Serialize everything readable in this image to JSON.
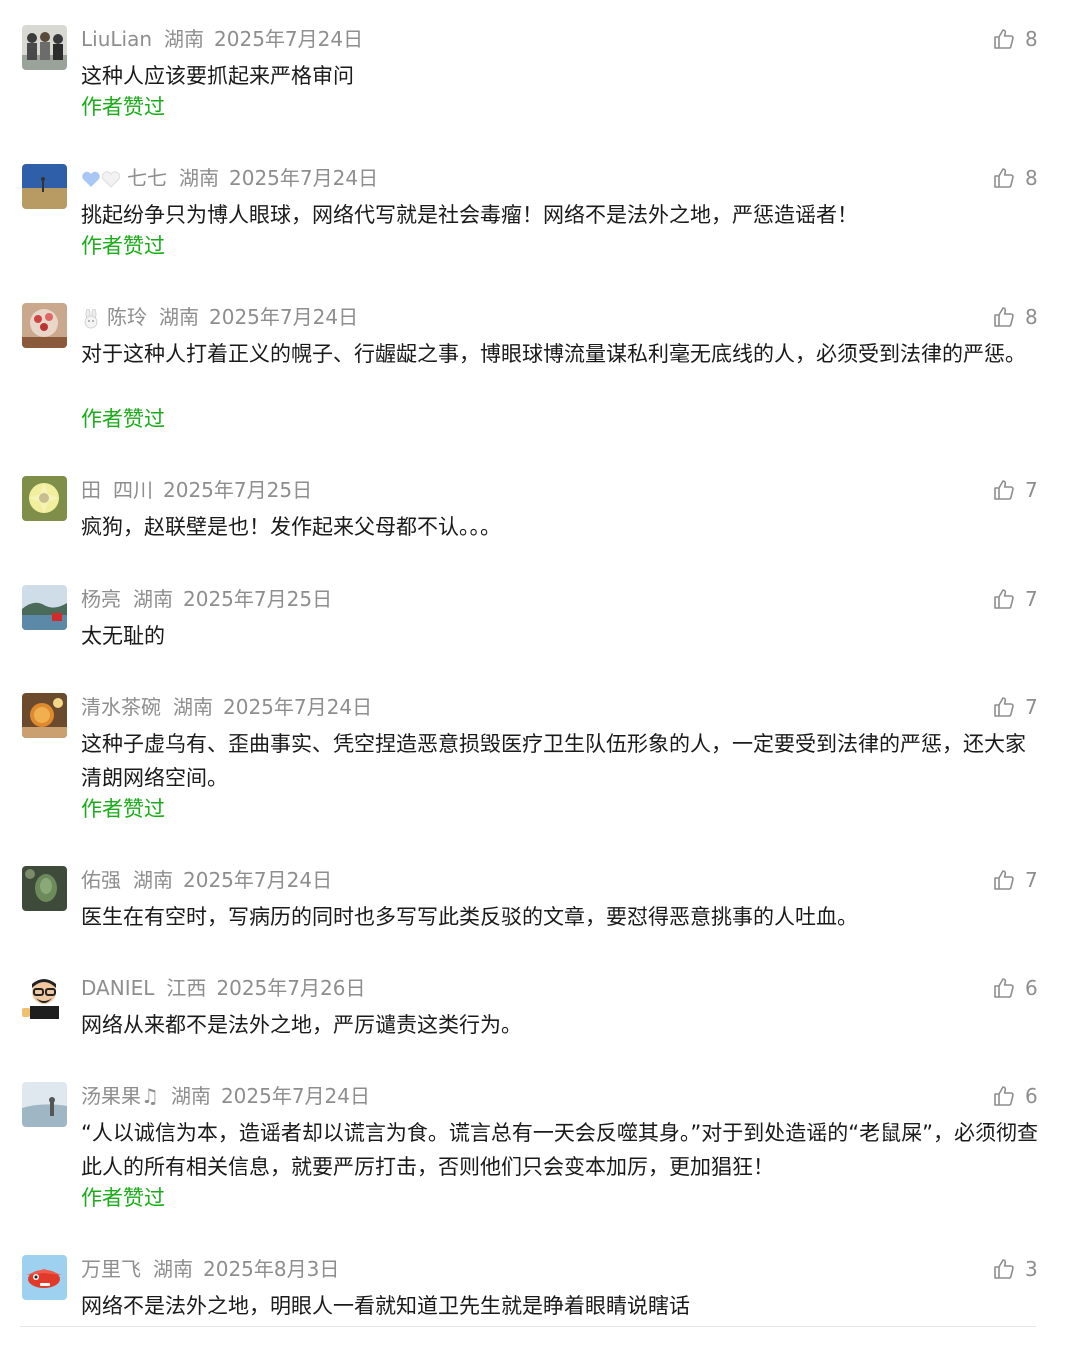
{
  "like_icon": "thumbs-up-outline-icon",
  "colors": {
    "meta": "#8e8e8e",
    "text": "#1a1a1a",
    "author_liked": "#1aad19"
  },
  "comments": [
    {
      "name": "LiuLian",
      "region": "湖南",
      "date": "2025年7月24日",
      "likes": "8",
      "text": "这种人应该要抓起来严格审问",
      "author_liked": "作者赞过"
    },
    {
      "name": "七七",
      "name_prefix_icons": [
        "blue-heart-icon",
        "white-heart-icon"
      ],
      "region": "湖南",
      "date": "2025年7月24日",
      "likes": "8",
      "text": "挑起纷争只为博人眼球，网络代写就是社会毒瘤！网络不是法外之地，严惩造谣者！",
      "author_liked": "作者赞过"
    },
    {
      "name": "陈玲",
      "name_prefix_icons": [
        "rabbit-icon"
      ],
      "region": "湖南",
      "date": "2025年7月24日",
      "likes": "8",
      "text": "对于这种人打着正义的幌子、行龌龊之事，博眼球博流量谋私利毫无底线的人，必须受到法律的严惩。",
      "author_liked": "作者赞过"
    },
    {
      "name": "田",
      "region": "四川",
      "date": "2025年7月25日",
      "likes": "7",
      "text": "疯狗，赵联壁是也！发作起来父母都不认。。。"
    },
    {
      "name": "杨亮",
      "region": "湖南",
      "date": "2025年7月25日",
      "likes": "7",
      "text": "太无耻的"
    },
    {
      "name": "清水茶碗",
      "region": "湖南",
      "date": "2025年7月24日",
      "likes": "7",
      "text": "这种子虚乌有、歪曲事实、凭空捏造恶意损毁医疗卫生队伍形象的人，一定要受到法律的严惩，还大家清朗网络空间。",
      "author_liked": "作者赞过"
    },
    {
      "name": "佑强",
      "region": "湖南",
      "date": "2025年7月24日",
      "likes": "7",
      "text": "医生在有空时，写病历的同时也多写写此类反驳的文章，要怼得恶意挑事的人吐血。"
    },
    {
      "name": "DANIEL",
      "region": "江西",
      "date": "2025年7月26日",
      "likes": "6",
      "text": "网络从来都不是法外之地，严厉谴责这类行为。"
    },
    {
      "name": "汤果果♫",
      "region": "湖南",
      "date": "2025年7月24日",
      "likes": "6",
      "text": "“人以诚信为本，造谣者却以谎言为食。谎言总有一天会反噬其身。”对于到处造谣的“老鼠屎”，必须彻查此人的所有相关信息，就要严厉打击，否则他们只会变本加厉，更加猖狂！",
      "author_liked": "作者赞过"
    },
    {
      "name": "万里飞",
      "region": "湖南",
      "date": "2025年8月3日",
      "likes": "3",
      "text": "网络不是法外之地，明眼人一看就知道卫先生就是睁着眼睛说瞎话"
    }
  ]
}
